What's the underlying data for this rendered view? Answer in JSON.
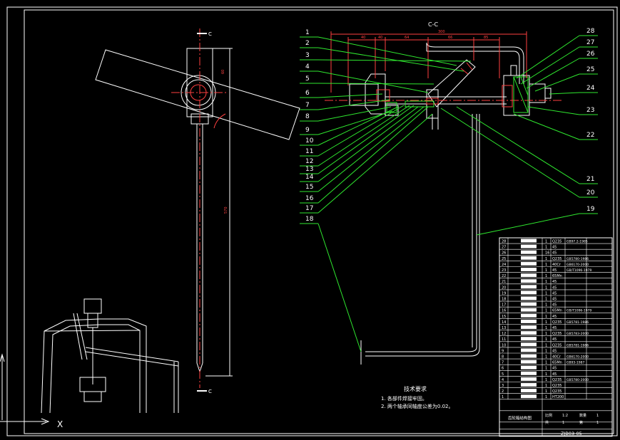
{
  "section_label": "C-C",
  "section_marks": [
    "C",
    "C"
  ],
  "callouts_left": [
    "1",
    "2",
    "3",
    "4",
    "5",
    "6",
    "7",
    "8",
    "9",
    "10",
    "11",
    "12",
    "13",
    "14",
    "15",
    "16",
    "17",
    "18"
  ],
  "callouts_right": [
    "28",
    "27",
    "26",
    "25",
    "24",
    "23",
    "22",
    "21",
    "20",
    "19"
  ],
  "dims_top": [
    "300",
    "40",
    "40",
    "64",
    "66",
    "85"
  ],
  "dim_left_view": [
    "60",
    "570"
  ],
  "tech_title": "技术要求",
  "tech_lines": [
    "1. 各部件焊接牢固。",
    "2. 两个轴承同轴度公差为0.02。"
  ],
  "bom": {
    "numbers": [
      "28",
      "27",
      "26",
      "25",
      "24",
      "23",
      "22",
      "21",
      "20",
      "19",
      "18",
      "17",
      "16",
      "15",
      "14",
      "13",
      "12",
      "11",
      "10",
      "9",
      "8",
      "7",
      "6",
      "5",
      "4",
      "3",
      "2",
      "1"
    ],
    "qty": [
      "1",
      "1",
      "16",
      "1",
      "1",
      "1",
      "1",
      "1",
      "1",
      "1",
      "1",
      "1",
      "1",
      "1",
      "1",
      "1",
      "1",
      "1",
      "1",
      "1",
      "1",
      "1",
      "1",
      "1",
      "1",
      "1",
      "1",
      "1"
    ],
    "material": [
      "Q235",
      "45",
      "45",
      "Q235",
      "40Cr",
      "45",
      "65Mn",
      "45",
      "45",
      "45",
      "45",
      "45",
      "65Mn",
      "45",
      "Q235",
      "45",
      "Q235",
      "45",
      "Q235",
      "45",
      "40Cr",
      "65Mn",
      "45",
      "45",
      "Q235",
      "Q235",
      "Q235",
      "HT200"
    ],
    "standard": [
      "GB97.2-1985",
      "",
      "",
      "GB5780-1986",
      "GB6170-2000",
      "GB/T1096-1979",
      "",
      "",
      "",
      "",
      "",
      "",
      "GB/T1096-1979",
      "",
      "GB5781-1986",
      "",
      "GB5783-2000",
      "",
      "GB5781-1986",
      "",
      "GB6170-2000",
      "GB93-1987",
      "",
      "",
      "GB5780-2000",
      "",
      "",
      ""
    ],
    "footer_name": "齿轮箱结构图",
    "footer_cells": [
      "比例",
      "1:2",
      "数量",
      "1",
      "共",
      "1",
      "第",
      "1"
    ],
    "drawing_no": "ZJB03-05"
  },
  "ucs_label": "X"
}
